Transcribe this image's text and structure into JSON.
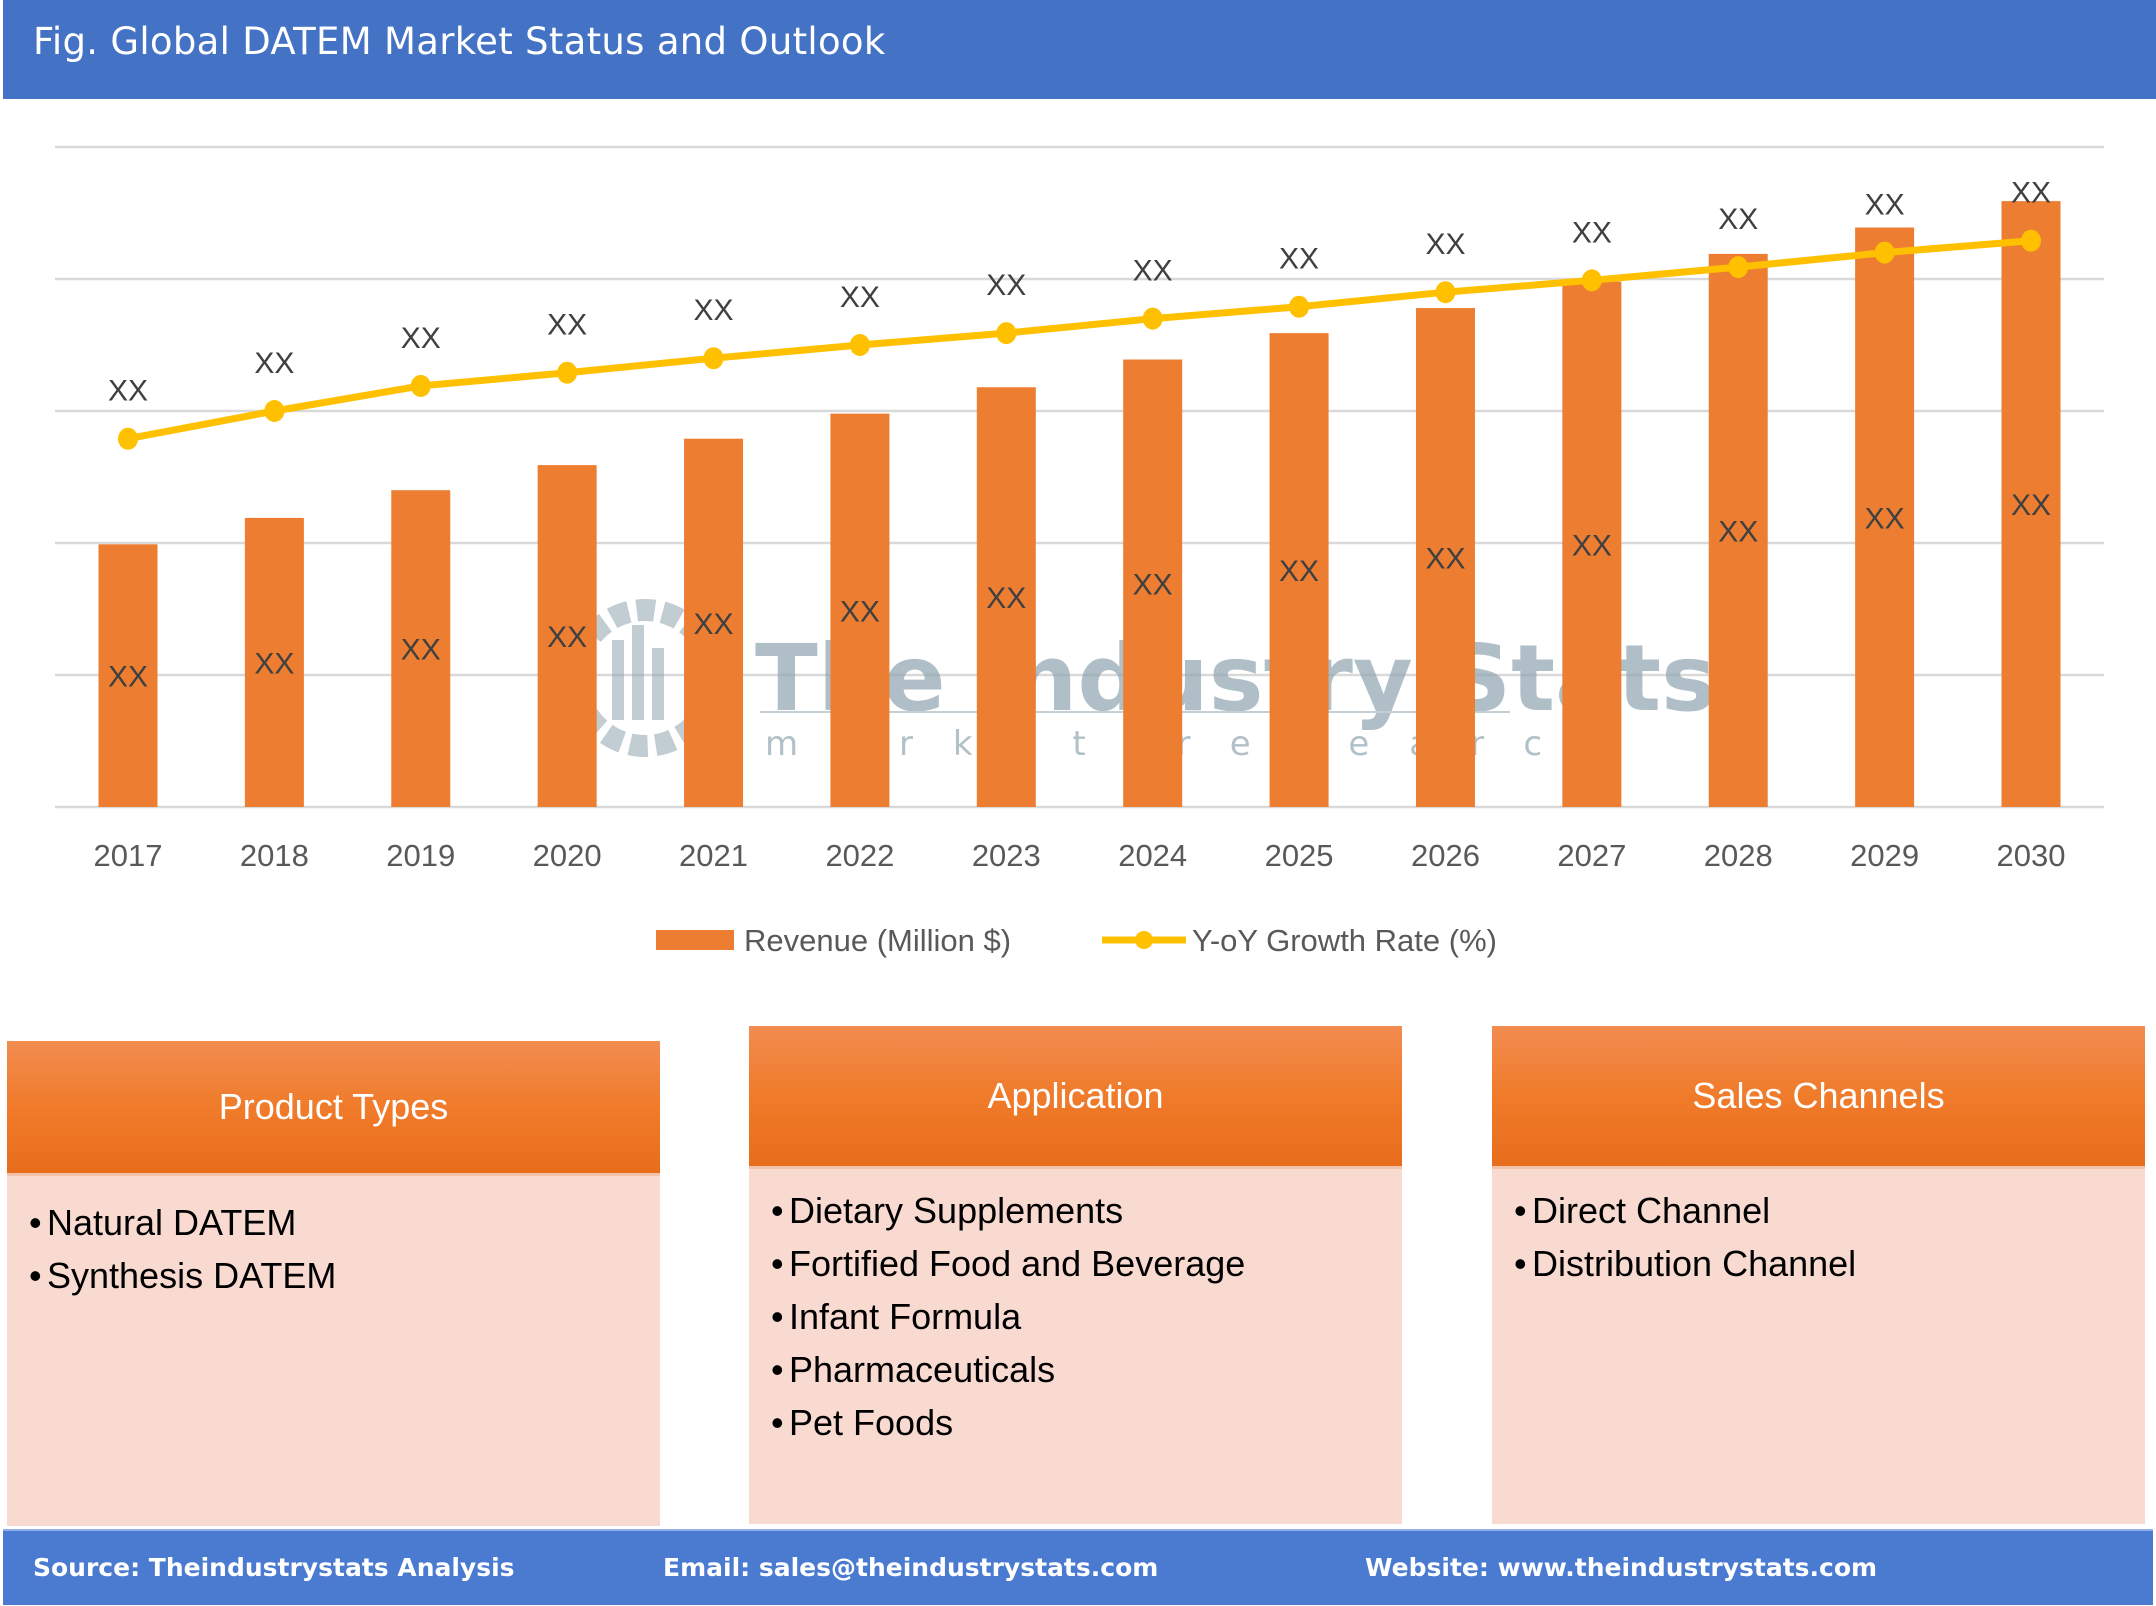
{
  "header": {
    "title": "Fig. Global DATEM Market Status and Outlook"
  },
  "colors": {
    "header_bg": "#4472C4",
    "bar": "#ED7D31",
    "line": "#FFC000",
    "gridline": "#D9D9D9",
    "panel_header": "#F07B2A",
    "panel_body": "#F9DAD1",
    "footer_bg": "#4A7BD0"
  },
  "watermark": {
    "title": "The Industry Stats",
    "subtitle": "market research"
  },
  "chart_data": {
    "type": "bar",
    "title": "Fig. Global DATEM Market Status and Outlook",
    "xlabel": "",
    "ylabel": "",
    "categories": [
      "2017",
      "2018",
      "2019",
      "2020",
      "2021",
      "2022",
      "2023",
      "2024",
      "2025",
      "2026",
      "2027",
      "2028",
      "2029",
      "2030"
    ],
    "ylim": [
      0,
      5
    ],
    "y_units": "relative gridline units (axis unlabeled)",
    "grid": true,
    "legend_position": "bottom-center",
    "series": [
      {
        "name": "Revenue (Million $)",
        "type": "bar",
        "values": [
          1.99,
          2.19,
          2.4,
          2.59,
          2.79,
          2.98,
          3.18,
          3.39,
          3.59,
          3.78,
          3.98,
          4.19,
          4.39,
          4.59
        ],
        "data_labels": [
          "XX",
          "XX",
          "XX",
          "XX",
          "XX",
          "XX",
          "XX",
          "XX",
          "XX",
          "XX",
          "XX",
          "XX",
          "XX",
          "XX"
        ]
      },
      {
        "name": "Y-oY Growth Rate (%)",
        "type": "line",
        "values": [
          2.79,
          3.0,
          3.19,
          3.29,
          3.4,
          3.5,
          3.59,
          3.7,
          3.79,
          3.9,
          3.99,
          4.09,
          4.2,
          4.29
        ],
        "data_labels": [
          "XX",
          "XX",
          "XX",
          "XX",
          "XX",
          "XX",
          "XX",
          "XX",
          "XX",
          "XX",
          "XX",
          "XX",
          "XX",
          "XX"
        ]
      }
    ]
  },
  "panels": [
    {
      "title": "Product Types",
      "items": [
        "Natural DATEM",
        "Synthesis DATEM"
      ]
    },
    {
      "title": "Application",
      "items": [
        "Dietary Supplements",
        "Fortified Food and Beverage",
        "Infant Formula",
        "Pharmaceuticals",
        "Pet Foods"
      ]
    },
    {
      "title": "Sales Channels",
      "items": [
        "Direct Channel",
        "Distribution Channel"
      ]
    }
  ],
  "bullet": "•",
  "footer": {
    "source": "Source: Theindustrystats Analysis",
    "email": "Email: sales@theindustrystats.com",
    "website": "Website: www.theindustrystats.com"
  }
}
